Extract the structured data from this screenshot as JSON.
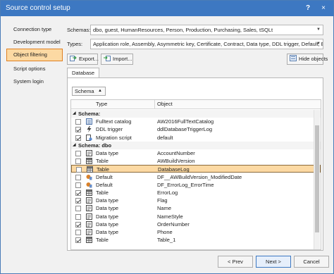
{
  "window": {
    "title": "Source control setup",
    "help": "?",
    "close": "×"
  },
  "nav": [
    {
      "label": "Connection type"
    },
    {
      "label": "Development model"
    },
    {
      "label": "Object filtering"
    },
    {
      "label": "Script options"
    },
    {
      "label": "System login"
    }
  ],
  "schemas": {
    "label": "Schemas:",
    "value": "dbo, guest, HumanResources, Person, Production, Purchasing, Sales, tSQLt"
  },
  "types": {
    "label": "Types:",
    "value": "Application role, Assembly, Asymmetric key, Certificate, Contract, Data type, DDL trigger, Default, Ev..."
  },
  "toolbar": {
    "export": "Export...",
    "import": "Import...",
    "hide": "Hide objects"
  },
  "tab": {
    "label": "Database"
  },
  "group_by": {
    "value": "Schema"
  },
  "grid": {
    "columns": {
      "type": "Type",
      "object": "Object"
    },
    "rows": [
      {
        "kind": "group",
        "text": "Schema:"
      },
      {
        "checked": false,
        "icon": "fulltext-catalog-icon",
        "type": "Fulltext catalog",
        "object": "AW2016FullTextCatalog"
      },
      {
        "checked": true,
        "icon": "ddl-trigger-icon",
        "type": "DDL trigger",
        "object": "ddlDatabaseTriggerLog"
      },
      {
        "checked": true,
        "icon": "migration-script-icon",
        "type": "Migration script",
        "object": "default"
      },
      {
        "kind": "group",
        "text": "Schema: dbo"
      },
      {
        "checked": false,
        "icon": "data-type-icon",
        "type": "Data type",
        "object": "AccountNumber"
      },
      {
        "checked": false,
        "icon": "table-icon",
        "type": "Table",
        "object": "AWBuildVersion"
      },
      {
        "checked": false,
        "icon": "table-icon",
        "type": "Table",
        "object": "DatabaseLog",
        "selected": true
      },
      {
        "checked": false,
        "icon": "default-icon",
        "type": "Default",
        "object": "DF__AWBuildVersion_ModifiedDate"
      },
      {
        "checked": false,
        "icon": "default-icon",
        "type": "Default",
        "object": "DF_ErrorLog_ErrorTime"
      },
      {
        "checked": true,
        "icon": "table-icon",
        "type": "Table",
        "object": "ErrorLog"
      },
      {
        "checked": true,
        "icon": "data-type-icon",
        "type": "Data type",
        "object": "Flag"
      },
      {
        "checked": false,
        "icon": "data-type-icon",
        "type": "Data type",
        "object": "Name"
      },
      {
        "checked": false,
        "icon": "data-type-icon",
        "type": "Data type",
        "object": "NameStyle"
      },
      {
        "checked": true,
        "icon": "data-type-icon",
        "type": "Data type",
        "object": "OrderNumber"
      },
      {
        "checked": false,
        "icon": "data-type-icon",
        "type": "Data type",
        "object": "Phone"
      },
      {
        "checked": true,
        "icon": "table-icon",
        "type": "Table",
        "object": "Table_1"
      }
    ]
  },
  "footer": {
    "prev": "< Prev",
    "next": "Next >",
    "cancel": "Cancel"
  },
  "colors": {
    "accent": "#3d78c2",
    "selection": "#fcd9a3",
    "nav_active_border": "#e08020"
  }
}
